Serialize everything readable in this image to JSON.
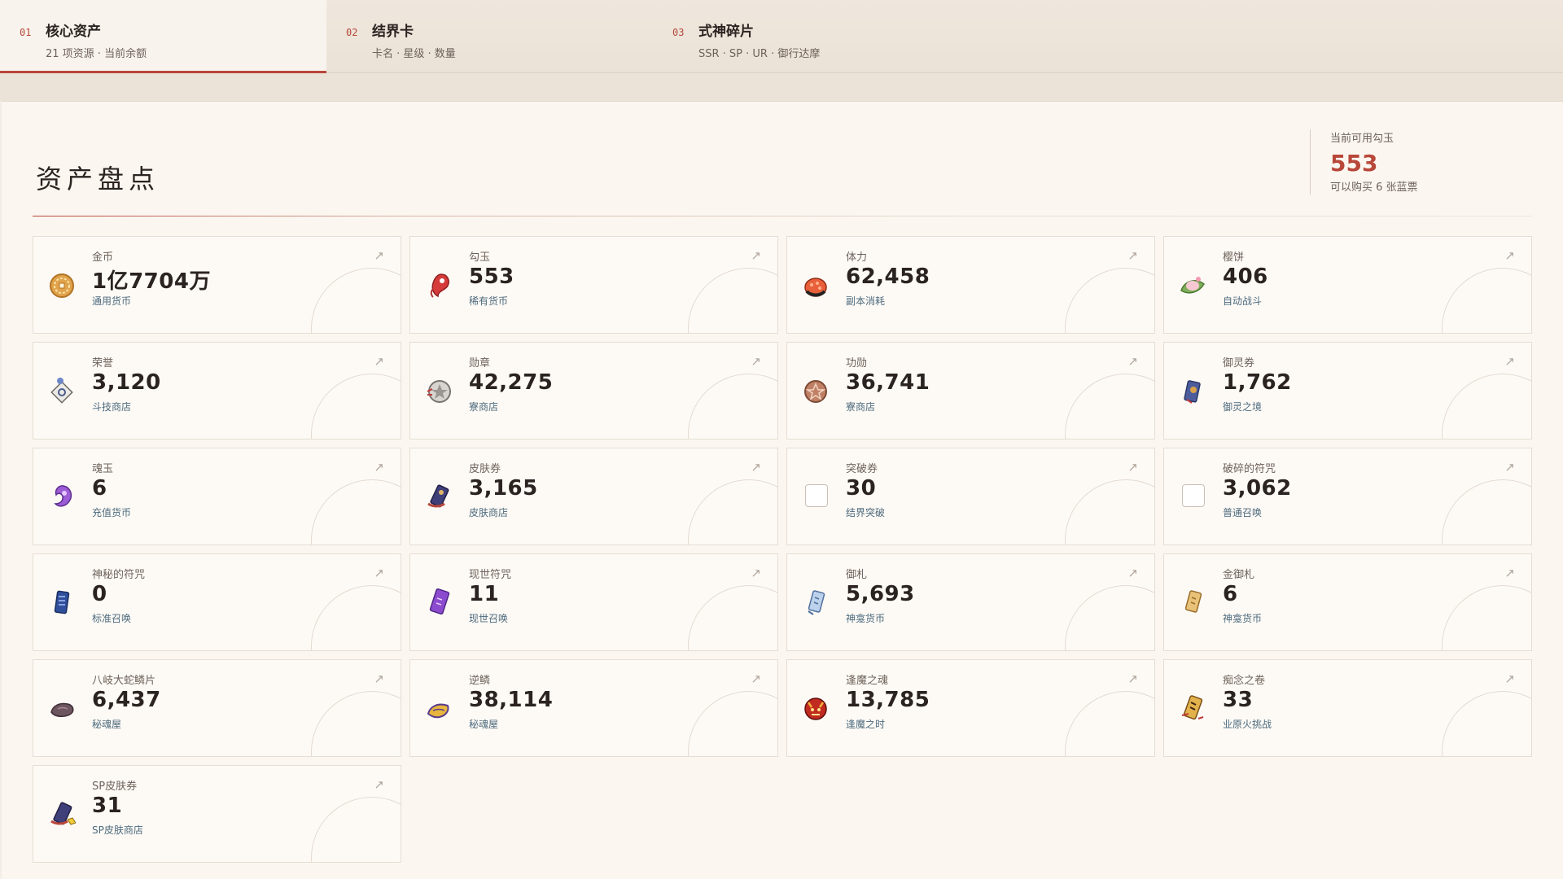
{
  "tabs": [
    {
      "num": "01",
      "title": "核心资产",
      "sub": "21 项资源 · 当前余额"
    },
    {
      "num": "02",
      "title": "结界卡",
      "sub": "卡名 · 星级 · 数量"
    },
    {
      "num": "03",
      "title": "式神碎片",
      "sub": "SSR · SP · UR · 御行达摩"
    }
  ],
  "page": {
    "heading": "资产盘点",
    "summary_label": "当前可用勾玉",
    "summary_value": "553",
    "summary_note": "可以购买 6 张蓝票"
  },
  "arrow_glyph": "↗",
  "cards": [
    {
      "name": "金币",
      "value": "1亿7704万",
      "tag": "通用货币",
      "icon": "gold-coin-icon"
    },
    {
      "name": "勾玉",
      "value": "553",
      "tag": "稀有货币",
      "icon": "magatama-icon"
    },
    {
      "name": "体力",
      "value": "62,458",
      "tag": "副本消耗",
      "icon": "stamina-sushi-icon"
    },
    {
      "name": "樱饼",
      "value": "406",
      "tag": "自动战斗",
      "icon": "sakura-mochi-icon"
    },
    {
      "name": "荣誉",
      "value": "3,120",
      "tag": "斗技商店",
      "icon": "honor-icon"
    },
    {
      "name": "勋章",
      "value": "42,275",
      "tag": "寮商店",
      "icon": "medal-icon"
    },
    {
      "name": "功勋",
      "value": "36,741",
      "tag": "寮商店",
      "icon": "merit-icon"
    },
    {
      "name": "御灵券",
      "value": "1,762",
      "tag": "御灵之境",
      "icon": "spirit-ticket-icon"
    },
    {
      "name": "魂玉",
      "value": "6",
      "tag": "充值货币",
      "icon": "soul-jade-icon"
    },
    {
      "name": "皮肤券",
      "value": "3,165",
      "tag": "皮肤商店",
      "icon": "skin-ticket-icon"
    },
    {
      "name": "突破券",
      "value": "30",
      "tag": "结界突破",
      "icon": "breakthrough-ticket-icon"
    },
    {
      "name": "破碎的符咒",
      "value": "3,062",
      "tag": "普通召唤",
      "icon": "broken-talisman-icon"
    },
    {
      "name": "神秘的符咒",
      "value": "0",
      "tag": "标准召唤",
      "icon": "mystery-talisman-icon"
    },
    {
      "name": "现世符咒",
      "value": "11",
      "tag": "现世召唤",
      "icon": "reality-talisman-icon"
    },
    {
      "name": "御札",
      "value": "5,693",
      "tag": "神龛货币",
      "icon": "ofuda-icon"
    },
    {
      "name": "金御札",
      "value": "6",
      "tag": "神龛货币",
      "icon": "gold-ofuda-icon"
    },
    {
      "name": "八岐大蛇鳞片",
      "value": "6,437",
      "tag": "秘魂屋",
      "icon": "orochi-scale-icon"
    },
    {
      "name": "逆鳞",
      "value": "38,114",
      "tag": "秘魂屋",
      "icon": "reverse-scale-icon"
    },
    {
      "name": "逢魔之魂",
      "value": "13,785",
      "tag": "逢魔之时",
      "icon": "demon-soul-icon"
    },
    {
      "name": "痴念之卷",
      "value": "33",
      "tag": "业原火挑战",
      "icon": "obsession-scroll-icon"
    },
    {
      "name": "SP皮肤券",
      "value": "31",
      "tag": "SP皮肤商店",
      "icon": "sp-skin-ticket-icon"
    }
  ]
}
